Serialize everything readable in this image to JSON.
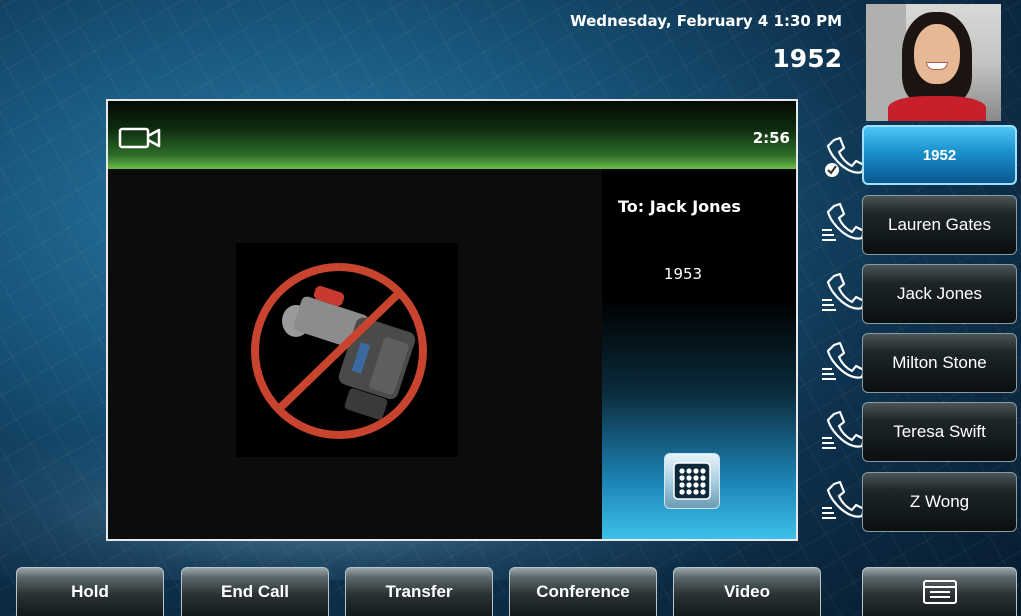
{
  "status": {
    "datetime": "Wednesday, February 4  1:30 PM",
    "line_number": "1952"
  },
  "call": {
    "timer": "2:56",
    "to_label": "To: Jack Jones",
    "callee_number": "1953",
    "video_state_icon": "video-muted-icon",
    "header_icon": "video-camera-icon"
  },
  "line_keys": [
    {
      "label": "1952",
      "icon": "phone-registered-icon",
      "active": true
    },
    {
      "label": "Lauren Gates",
      "icon": "phone-handset-icon",
      "active": false
    },
    {
      "label": "Jack Jones",
      "icon": "phone-handset-icon",
      "active": false
    },
    {
      "label": "Milton Stone",
      "icon": "phone-handset-icon",
      "active": false
    },
    {
      "label": "Teresa Swift",
      "icon": "phone-handset-icon",
      "active": false
    },
    {
      "label": "Z Wong",
      "icon": "phone-handset-icon",
      "active": false
    }
  ],
  "softkeys": {
    "hold": "Hold",
    "end_call": "End Call",
    "transfer": "Transfer",
    "conference": "Conference",
    "video": "Video",
    "menu_icon": "menu-icon"
  },
  "colors": {
    "accent": "#1a90cc",
    "header_green": "#6cba4a"
  }
}
